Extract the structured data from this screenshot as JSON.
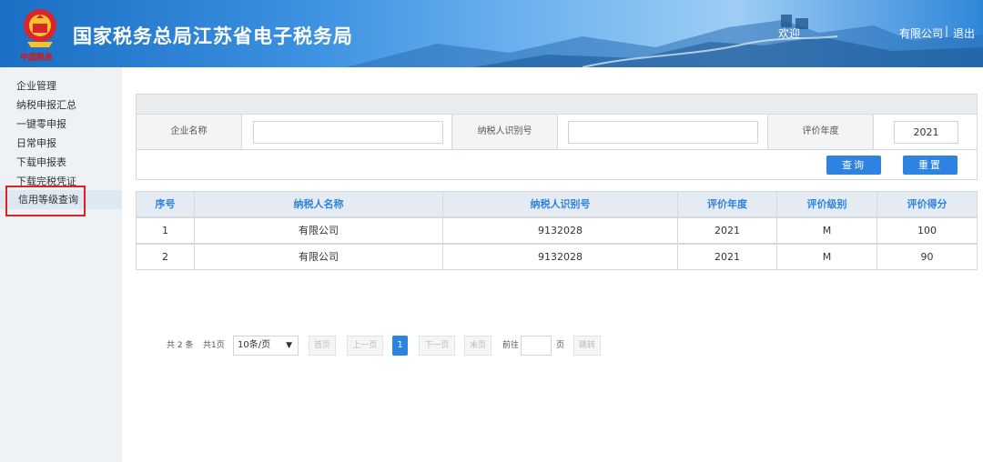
{
  "header": {
    "brand_small": "中国税务",
    "site_title": "国家税务总局江苏省电子税务局",
    "welcome": "欢迎",
    "company": "有限公司",
    "separator": "|",
    "logout": "退出",
    "emblem_icon": "tax-emblem-icon"
  },
  "sidebar": {
    "items": [
      {
        "label": "企业管理"
      },
      {
        "label": "纳税申报汇总"
      },
      {
        "label": "一键零申报"
      },
      {
        "label": "日常申报"
      },
      {
        "label": "下载申报表"
      },
      {
        "label": "下载完税凭证"
      },
      {
        "label": "信用等级查询"
      }
    ],
    "active_index": 6
  },
  "search": {
    "company_label": "企业名称",
    "company_value": "",
    "taxid_label": "纳税人识别号",
    "taxid_value": "",
    "year_label": "评价年度",
    "year_value": "2021",
    "query_button": "查询",
    "reset_button": "重置"
  },
  "table": {
    "columns": [
      "序号",
      "纳税人名称",
      "纳税人识别号",
      "评价年度",
      "评价级别",
      "评价得分"
    ],
    "rows": [
      [
        "1",
        "有限公司",
        "9132028",
        "2021",
        "M",
        "100"
      ],
      [
        "2",
        "有限公司",
        "9132028",
        "2021",
        "M",
        "90"
      ]
    ]
  },
  "pager": {
    "total": "共 2 条",
    "pages": "共1页",
    "page_size": "10条/页",
    "first": "首页",
    "prev": "上一页",
    "current": "1",
    "next": "下一页",
    "last": "末页",
    "goto_label": "前往",
    "page_unit": "页",
    "jump": "跳转"
  },
  "colors": {
    "accent": "#2f83e0",
    "highlight_box": "#e02020"
  }
}
